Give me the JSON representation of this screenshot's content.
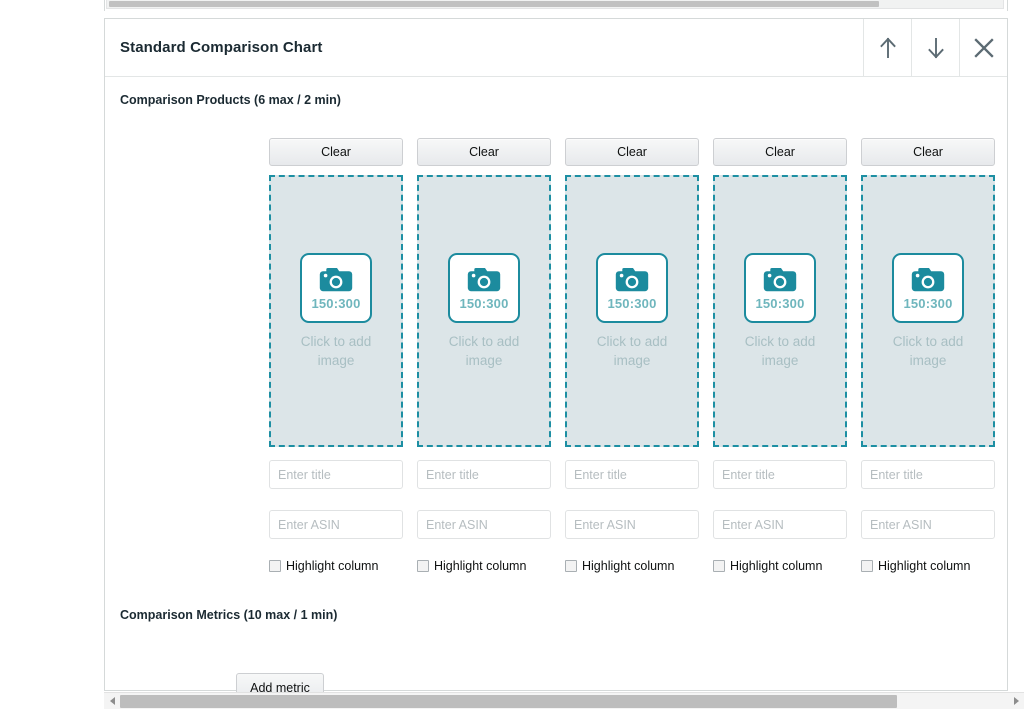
{
  "panel": {
    "title": "Standard Comparison Chart",
    "header_actions": [
      {
        "name": "move-up-button",
        "icon": "arrow-up-icon",
        "label": "↑"
      },
      {
        "name": "move-down-button",
        "icon": "arrow-down-icon",
        "label": "↓"
      },
      {
        "name": "close-button",
        "icon": "close-icon",
        "label": "✕"
      }
    ]
  },
  "products_section": {
    "label": "Comparison Products (6 max / 2 min)",
    "clear_label": "Clear",
    "dropzone": {
      "ratio": "150:300",
      "caption": "Click to add image",
      "icon": "camera-icon"
    },
    "title_placeholder": "Enter title",
    "asin_placeholder": "Enter ASIN",
    "highlight_label": "Highlight column",
    "columns": [
      {
        "title_value": "",
        "asin_value": "",
        "highlight_checked": false
      },
      {
        "title_value": "",
        "asin_value": "",
        "highlight_checked": false
      },
      {
        "title_value": "",
        "asin_value": "",
        "highlight_checked": false
      },
      {
        "title_value": "",
        "asin_value": "",
        "highlight_checked": false
      },
      {
        "title_value": "",
        "asin_value": "",
        "highlight_checked": false
      }
    ]
  },
  "metrics_section": {
    "label": "Comparison Metrics (10 max / 1 min)",
    "add_metric_label": "Add metric"
  },
  "colors": {
    "accent_teal": "#1c8b9e",
    "dropzone_fill": "#dce5e8",
    "ratio_text": "#6fb6bd",
    "caption_text": "#a8bfc3",
    "panel_border": "#d5d9d9",
    "text_primary": "#0f1111"
  }
}
